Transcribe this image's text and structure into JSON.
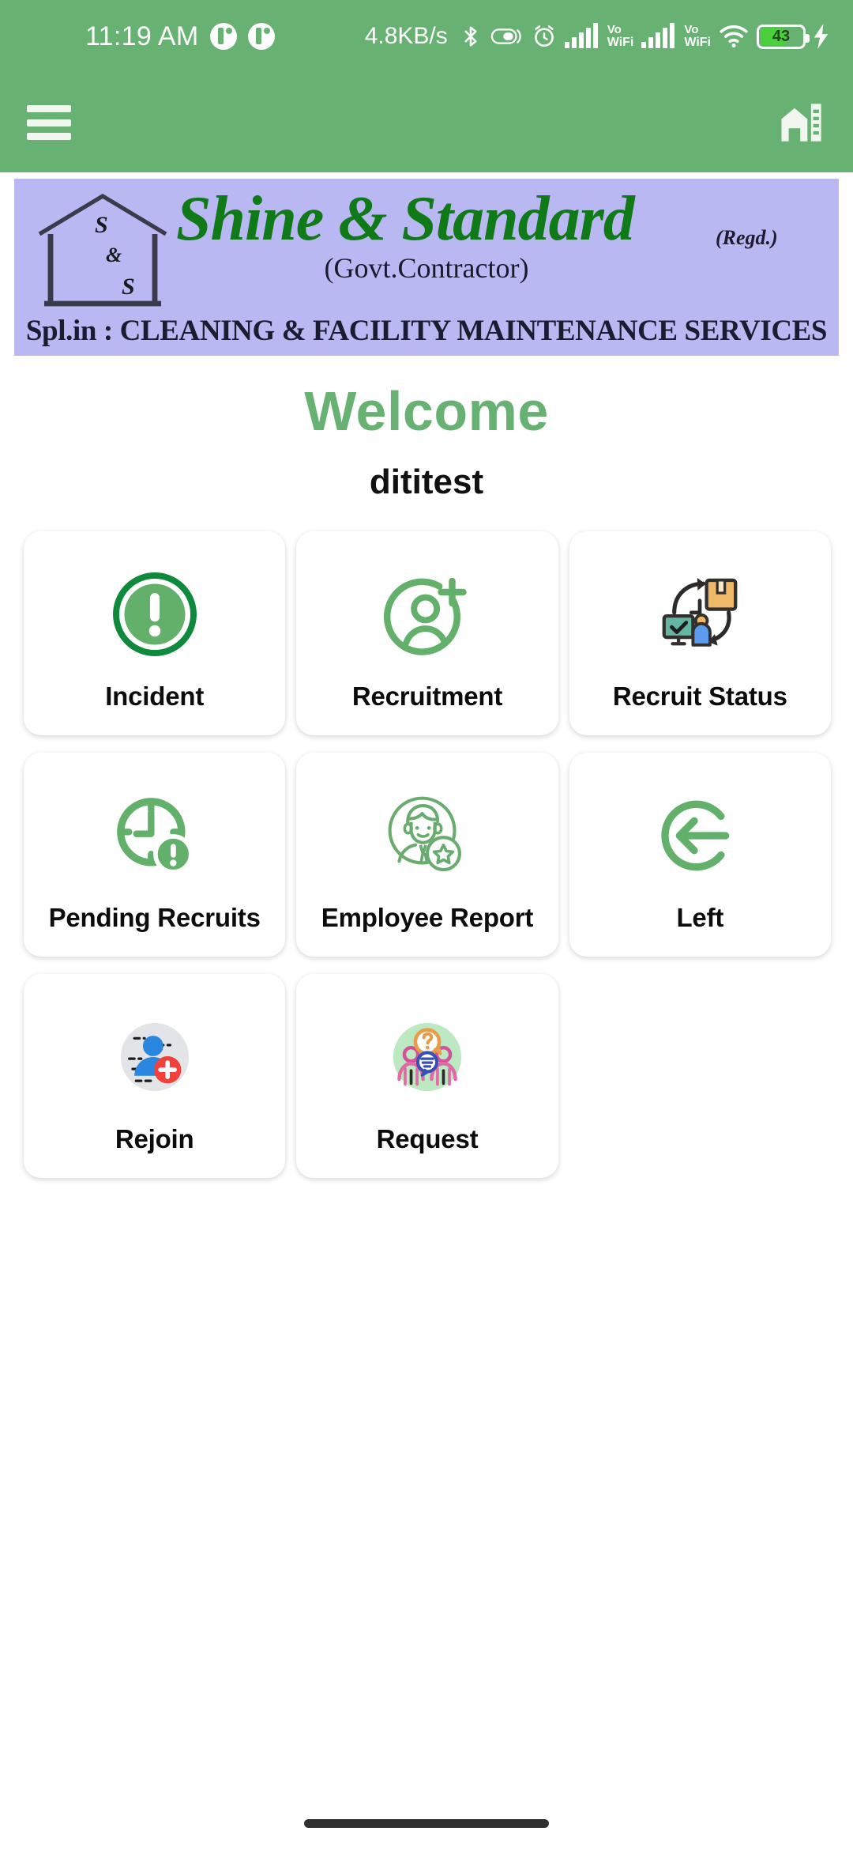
{
  "status_bar": {
    "time": "11:19 AM",
    "network_rate": "4.8KB/s",
    "battery_level": "43",
    "vowifi_top": "Vo",
    "vowifi_bottom": "WiFi",
    "icons": [
      "notification-dot-icon",
      "notification-dot-icon",
      "bluetooth-icon",
      "data-saver-icon",
      "alarm-icon",
      "signal-bars-icon",
      "vowifi-icon",
      "signal-bars-icon",
      "vowifi-icon",
      "wifi-icon",
      "battery-icon",
      "charging-bolt-icon"
    ]
  },
  "app_bar": {
    "menu_icon": "hamburger-menu-icon",
    "logo_icon": "building-home-icon"
  },
  "banner": {
    "brand_name": "Shine & Standard",
    "registered": "(Regd.)",
    "subtitle": "(Govt.Contractor)",
    "specialization": "Spl.in : CLEANING & FACILITY MAINTENANCE SERVICES",
    "logo_letters": {
      "s1": "S",
      "amp": "&",
      "s2": "S"
    },
    "background_color": "#b9b8f2",
    "brand_color": "#107a18"
  },
  "header": {
    "welcome_text": "Welcome",
    "username": "dititest",
    "welcome_color": "#67b273"
  },
  "theme": {
    "primary_green": "#67b273",
    "icon_green": "#63b06b",
    "dark_green": "#0f8a3c"
  },
  "menu": {
    "items": [
      {
        "label": "Incident",
        "icon": "alert-circle-icon"
      },
      {
        "label": "Recruitment",
        "icon": "person-add-circle-icon"
      },
      {
        "label": "Recruit Status",
        "icon": "workflow-status-icon"
      },
      {
        "label": "Pending Recruits",
        "icon": "clock-alert-icon"
      },
      {
        "label": "Employee Report",
        "icon": "employee-star-icon"
      },
      {
        "label": "Left",
        "icon": "logout-arrow-icon"
      },
      {
        "label": "Rejoin",
        "icon": "user-plus-badge-icon"
      },
      {
        "label": "Request",
        "icon": "people-question-icon"
      }
    ]
  },
  "navigation": {
    "gesture_bar": "gesture-bar"
  }
}
